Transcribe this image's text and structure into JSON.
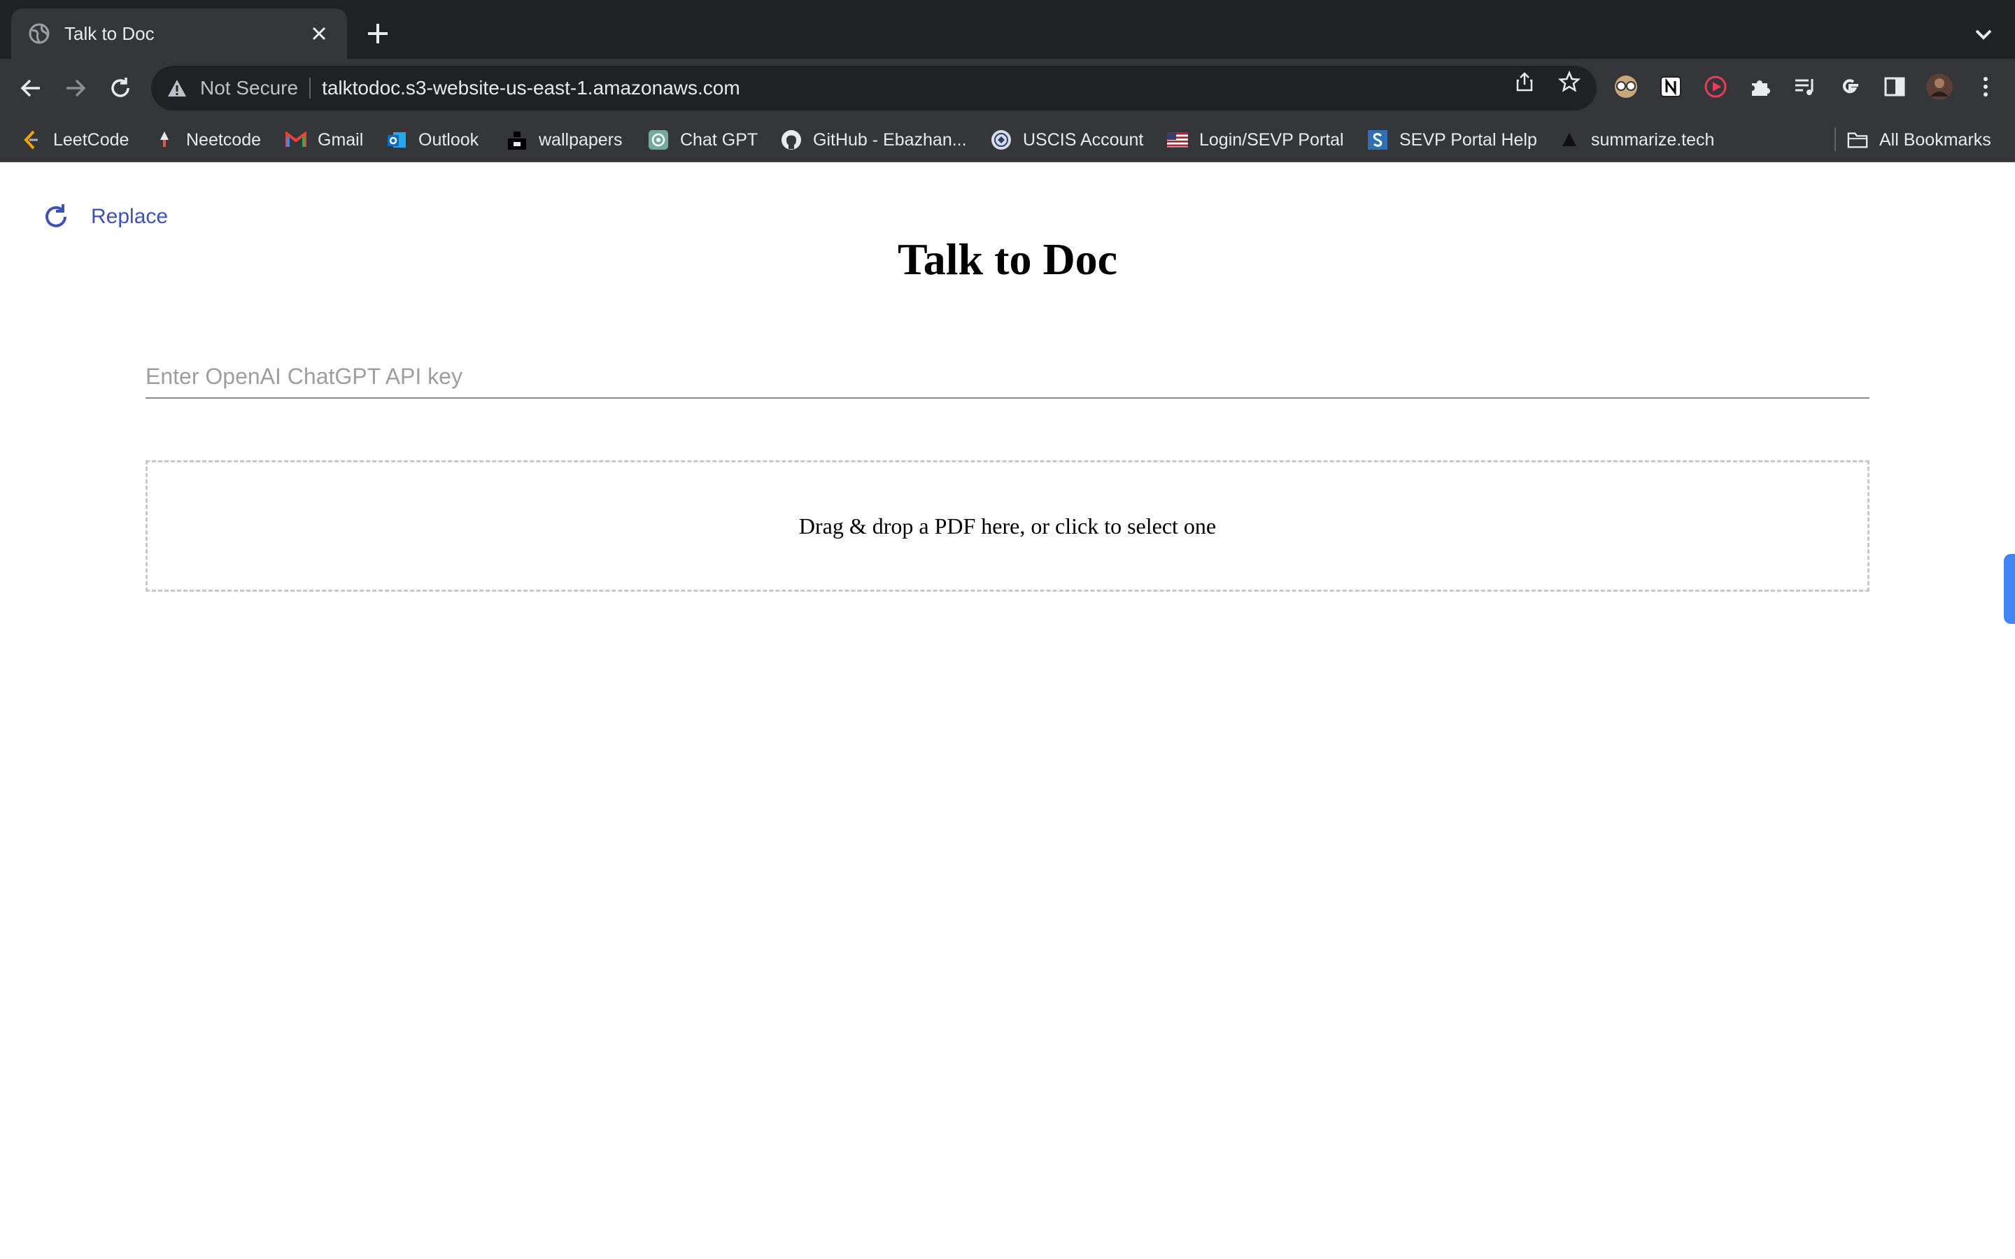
{
  "browser": {
    "tab": {
      "title": "Talk to Doc",
      "favicon": "globe-icon"
    },
    "address_bar": {
      "security_label": "Not Secure",
      "url": "talktodoc.s3-website-us-east-1.amazonaws.com"
    },
    "bookmarks": [
      {
        "label": "LeetCode",
        "icon": "leetcode-icon"
      },
      {
        "label": "Neetcode",
        "icon": "neetcode-icon"
      },
      {
        "label": "Gmail",
        "icon": "gmail-icon"
      },
      {
        "label": "Outlook",
        "icon": "outlook-icon"
      },
      {
        "label": "wallpapers",
        "icon": "unsplash-icon"
      },
      {
        "label": "Chat GPT",
        "icon": "chatgpt-icon"
      },
      {
        "label": "GitHub - Ebazhan...",
        "icon": "github-icon"
      },
      {
        "label": "USCIS Account",
        "icon": "uscis-icon"
      },
      {
        "label": "Login/SEVP Portal",
        "icon": "us-flag-icon"
      },
      {
        "label": "SEVP Portal Help",
        "icon": "s-icon"
      },
      {
        "label": "summarize.tech",
        "icon": "summarize-icon"
      }
    ],
    "all_bookmarks_label": "All Bookmarks"
  },
  "page": {
    "replace_label": "Replace",
    "title": "Talk to Doc",
    "api_key_placeholder": "Enter OpenAI ChatGPT API key",
    "dropzone_text": "Drag & drop a PDF here, or click to select one"
  },
  "colors": {
    "chrome_dark": "#202124",
    "chrome_toolbar": "#35363a",
    "accent_link": "#3f51b5",
    "side_handle": "#4285f4"
  }
}
